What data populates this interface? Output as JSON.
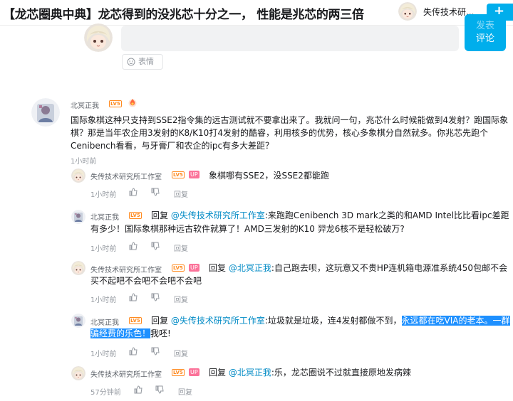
{
  "header": {
    "title": "【龙芯圈典中典】龙芯得到的没兆芯十分之一， 性能是兆芯的两三倍",
    "username": "失传技术研...",
    "follow_icon": "+"
  },
  "editor": {
    "submit_line1": "发表",
    "submit_line2": "评论",
    "emoji_label": "表情"
  },
  "main_comment": {
    "user": "北冥正我",
    "level": "LV5",
    "lines": [
      "国际象棋这种只支持到SSE2指令集的远古测试就不要拿出来了。我就问一句，兆芯什么时候能做到4发射？跑国际象",
      "棋？那是当年农企用3发射的K8/K10打4发射的酷睿，利用核多的优势，核心多象棋分自然就多。你兆芯先跑个",
      "Cenibench看看，与牙膏厂和农企的ipc有多大差距？"
    ],
    "time": "1小时前"
  },
  "replies": [
    {
      "user": "失传技术研究所工作室",
      "level": "LV5",
      "up": "UP",
      "line1": "象棋哪有SSE2，没SSE2都能跑",
      "time": "1小时前",
      "reply_label": "回复"
    },
    {
      "user": "北冥正我",
      "level": "LV5",
      "reply_prefix": "回复",
      "mention": "@失传技术研究所工作室",
      "line1": ":来跑跑Cenibench 3D mark之类的和AMD Intel比比看ipc差距",
      "line2": "有多少！国际象棋那种远古软件就算了！AMD三发射的K10 羿龙6核不是轻松破万?",
      "time": "1小时前",
      "reply_label": "回复"
    },
    {
      "user": "失传技术研究所工作室",
      "level": "LV5",
      "up": "UP",
      "reply_prefix": "回复",
      "mention": "@北冥正我",
      "line1": ":自己跑去呗，这玩意又不贵HP连机箱电源准系统450包邮不会",
      "line2": "买不起吧不会吧不会吧不会吧",
      "time": "1小时前",
      "reply_label": "回复"
    },
    {
      "user": "北冥正我",
      "level": "LV5",
      "reply_prefix": "回复",
      "mention": "@失传技术研究所工作室",
      "line1": ":垃圾就是垃圾，连4发射都做不到，",
      "highlight1": "永远都在吃VIA的老本。一群",
      "highlight2": "骗经费的乐色！",
      "line2_rest": "我呸!",
      "time": "1小时前",
      "reply_label": "回复"
    },
    {
      "user": "失传技术研究所工作室",
      "level": "LV5",
      "up": "UP",
      "reply_prefix": "回复",
      "mention": "@北冥正我",
      "line1": ":乐，龙芯圈说不过就直接原地发病辣",
      "time": "57分钟前",
      "reply_label": "回复"
    }
  ],
  "colors": {
    "accent": "#00aeec",
    "mention": "#008ac5",
    "level_badge": "#ff8a1f",
    "up_badge": "#fb7299",
    "highlight": "#1e90ff"
  },
  "icons": {
    "anime_avatar": "anime-girl-avatar",
    "portrait_avatar": "portrait-avatar",
    "like": "thumbs-up",
    "dislike": "thumbs-down",
    "emoji": "smile-face",
    "fan_badge": "flame-badge"
  }
}
